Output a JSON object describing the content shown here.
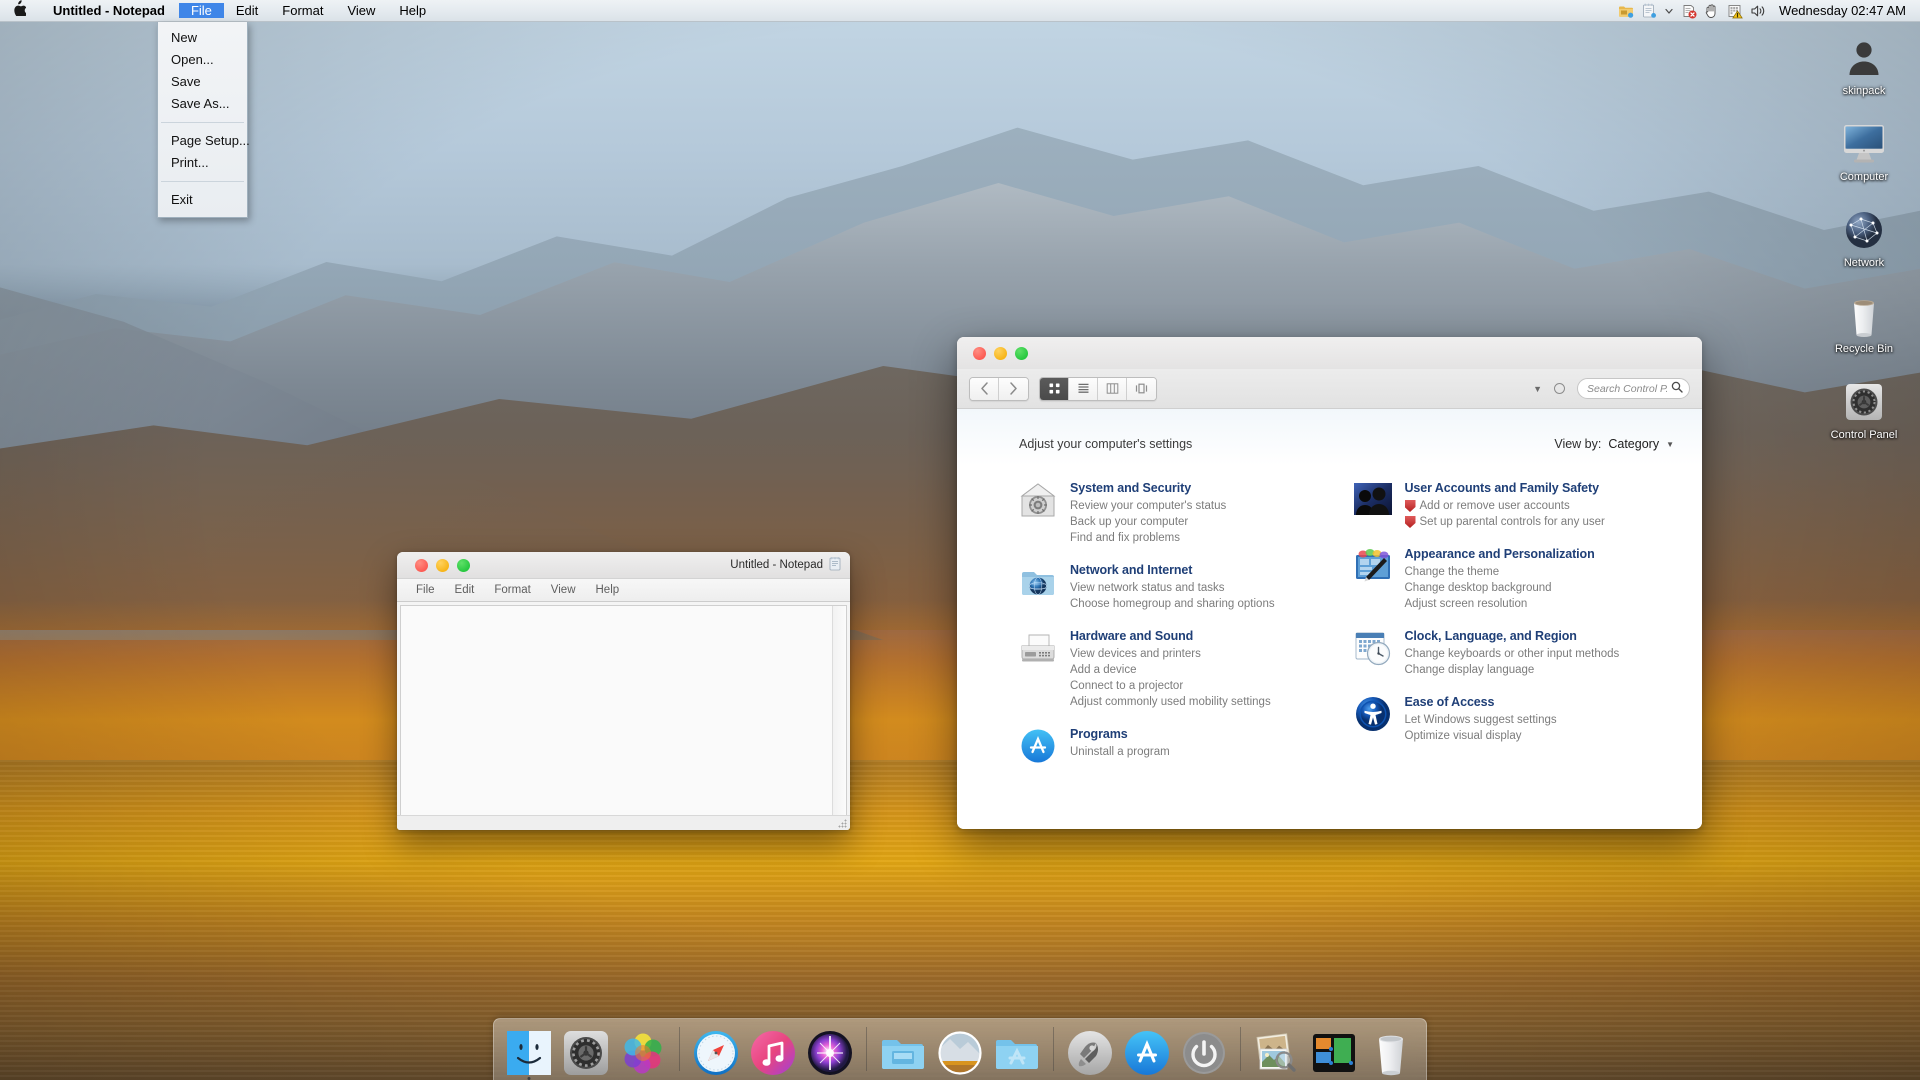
{
  "menubar": {
    "apple_icon": "apple-logo-icon",
    "app_title": "Untitled - Notepad",
    "items": [
      {
        "label": "File",
        "open": true
      },
      {
        "label": "Edit",
        "open": false
      },
      {
        "label": "Format",
        "open": false
      },
      {
        "label": "View",
        "open": false
      },
      {
        "label": "Help",
        "open": false
      }
    ],
    "tray_icons": [
      "folder-share-icon",
      "notepad-tray-icon",
      "chevron-down-icon",
      "network-error-icon",
      "hand-hold-icon",
      "security-warning-icon",
      "volume-icon"
    ],
    "clock": "Wednesday 02:47 AM"
  },
  "file_menu": {
    "groups": [
      [
        "New",
        "Open...",
        "Save",
        "Save As..."
      ],
      [
        "Page Setup...",
        "Print..."
      ],
      [
        "Exit"
      ]
    ]
  },
  "control_panel": {
    "toolbar": {
      "back_icon": "chevron-left-icon",
      "forward_icon": "chevron-right-icon",
      "view_modes": [
        {
          "name": "icon-view",
          "active": true
        },
        {
          "name": "list-view",
          "active": false
        },
        {
          "name": "column-view",
          "active": false
        },
        {
          "name": "gallery-view",
          "active": false
        }
      ],
      "action_caret": "chevron-down-icon",
      "action_gear": "gear-icon",
      "search_placeholder": "Search Control P...",
      "search_icon": "search-icon"
    },
    "heading": "Adjust your computer's settings",
    "view_by_label": "View by:",
    "view_by_value": "Category",
    "categories_left": [
      {
        "icon": "system-security-icon",
        "title": "System and Security",
        "links": [
          {
            "text": "Review your computer's status",
            "shield": false
          },
          {
            "text": "Back up your computer",
            "shield": false
          },
          {
            "text": "Find and fix problems",
            "shield": false
          }
        ]
      },
      {
        "icon": "network-internet-icon",
        "title": "Network and Internet",
        "links": [
          {
            "text": "View network status and tasks",
            "shield": false
          },
          {
            "text": "Choose homegroup and sharing options",
            "shield": false
          }
        ]
      },
      {
        "icon": "hardware-sound-icon",
        "title": "Hardware and Sound",
        "links": [
          {
            "text": "View devices and printers",
            "shield": false
          },
          {
            "text": "Add a device",
            "shield": false
          },
          {
            "text": "Connect to a projector",
            "shield": false
          },
          {
            "text": "Adjust commonly used mobility settings",
            "shield": false
          }
        ]
      },
      {
        "icon": "programs-icon",
        "title": "Programs",
        "links": [
          {
            "text": "Uninstall a program",
            "shield": false
          }
        ]
      }
    ],
    "categories_right": [
      {
        "icon": "user-accounts-icon",
        "title": "User Accounts and Family Safety",
        "links": [
          {
            "text": "Add or remove user accounts",
            "shield": true
          },
          {
            "text": "Set up parental controls for any user",
            "shield": true
          }
        ]
      },
      {
        "icon": "appearance-icon",
        "title": "Appearance and Personalization",
        "links": [
          {
            "text": "Change the theme",
            "shield": false
          },
          {
            "text": "Change desktop background",
            "shield": false
          },
          {
            "text": "Adjust screen resolution",
            "shield": false
          }
        ]
      },
      {
        "icon": "clock-language-icon",
        "title": "Clock, Language, and Region",
        "links": [
          {
            "text": "Change keyboards or other input methods",
            "shield": false
          },
          {
            "text": "Change display language",
            "shield": false
          }
        ]
      },
      {
        "icon": "ease-of-access-icon",
        "title": "Ease of Access",
        "links": [
          {
            "text": "Let Windows suggest settings",
            "shield": false
          },
          {
            "text": "Optimize visual display",
            "shield": false
          }
        ]
      }
    ]
  },
  "notepad": {
    "title": "Untitled - Notepad",
    "title_icon": "notepad-icon",
    "menu": [
      "File",
      "Edit",
      "Format",
      "View",
      "Help"
    ],
    "content": ""
  },
  "desktop_icons": [
    {
      "label": "skinpack",
      "icon": "user-avatar-icon"
    },
    {
      "label": "Computer",
      "icon": "imac-computer-icon"
    },
    {
      "label": "Network",
      "icon": "network-globe-icon"
    },
    {
      "label": "Recycle Bin",
      "icon": "recycle-bin-icon"
    },
    {
      "label": "Control Panel",
      "icon": "control-panel-gear-icon"
    }
  ],
  "dock": {
    "items": [
      {
        "name": "finder-icon",
        "running": true,
        "type": "app"
      },
      {
        "name": "system-preferences-icon",
        "running": false,
        "type": "app"
      },
      {
        "name": "photos-icon",
        "running": false,
        "type": "app"
      },
      {
        "name": "separator",
        "type": "sep"
      },
      {
        "name": "safari-icon",
        "running": false,
        "type": "app"
      },
      {
        "name": "itunes-icon",
        "running": false,
        "type": "app"
      },
      {
        "name": "siri-icon",
        "running": false,
        "type": "app"
      },
      {
        "name": "separator",
        "type": "sep"
      },
      {
        "name": "downloads-folder-icon",
        "running": false,
        "type": "app"
      },
      {
        "name": "pictures-stack-icon",
        "running": false,
        "type": "app"
      },
      {
        "name": "applications-folder-icon",
        "running": false,
        "type": "app"
      },
      {
        "name": "separator",
        "type": "sep"
      },
      {
        "name": "launchpad-icon",
        "running": false,
        "type": "app"
      },
      {
        "name": "app-store-icon",
        "running": false,
        "type": "app"
      },
      {
        "name": "power-icon",
        "running": false,
        "type": "app"
      },
      {
        "name": "separator",
        "type": "sep"
      },
      {
        "name": "preview-icon",
        "running": false,
        "type": "app"
      },
      {
        "name": "mission-control-icon",
        "running": false,
        "type": "app"
      },
      {
        "name": "trash-icon",
        "running": false,
        "type": "app"
      }
    ]
  },
  "colors": {
    "accent_blue": "#3f86e8",
    "category_title": "#1f3f77",
    "link_gray": "#7c7c7c",
    "traffic_red": "#fc5c54",
    "traffic_yellow": "#f7b519",
    "traffic_green": "#28c840"
  }
}
